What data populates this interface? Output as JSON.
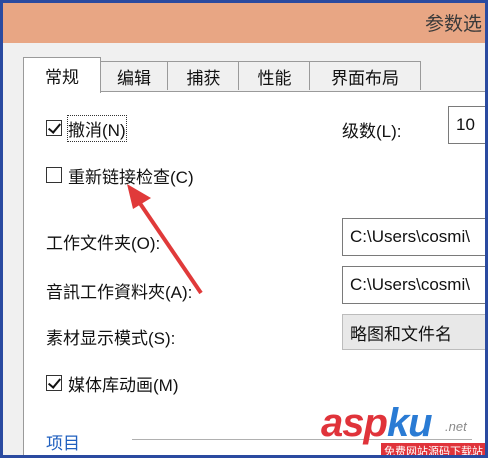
{
  "window": {
    "title": "参数选"
  },
  "tabs": [
    "常规",
    "编辑",
    "捕获",
    "性能",
    "界面布局"
  ],
  "general": {
    "undo": {
      "label": "撤消(N)",
      "checked": true
    },
    "levels": {
      "label": "级数(L):",
      "value": "10"
    },
    "relink": {
      "label": "重新链接检查(C)",
      "checked": false
    },
    "work_folder": {
      "label": "工作文件夹(O):",
      "value": "C:\\Users\\cosmi\\"
    },
    "audio_folder": {
      "label": "音訊工作資料夾(A):",
      "value": "C:\\Users\\cosmi\\"
    },
    "display_mode": {
      "label": "素材显示模式(S):",
      "value": "略图和文件名"
    },
    "media_anim": {
      "label": "媒体库动画(M)",
      "checked": true
    },
    "section": "项目"
  },
  "watermark": {
    "text_a": "asp",
    "text_b": "ku",
    "net": ".net",
    "sub": "免费网站源码下载站"
  },
  "colors": {
    "title_bar": "#e8a684",
    "frame_border": "#2a4aa0",
    "arrow": "#e03a3a",
    "link": "#1f5fbf"
  }
}
